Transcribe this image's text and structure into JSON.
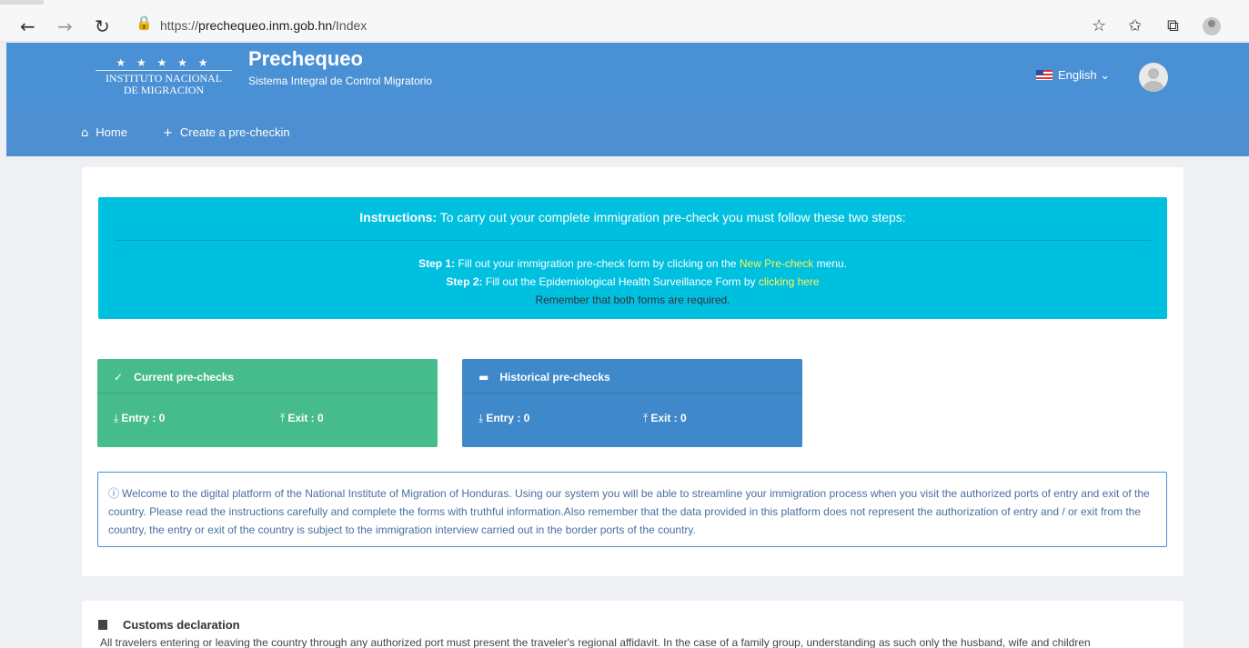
{
  "browser": {
    "url_prefix": "https://",
    "url_host": "prechequeo.inm.gob.hn",
    "url_path": "/Index",
    "back_icon": "back-arrow-icon",
    "forward_icon": "forward-arrow-icon",
    "reload_icon": "reload-icon",
    "lock_icon": "lock-icon"
  },
  "header": {
    "logo_stars": "★ ★ ★ ★ ★",
    "logo_line1": "INSTITUTO NACIONAL",
    "logo_line2": "DE MIGRACION",
    "title": "Prechequeo",
    "subtitle": "Sistema Integral de Control Migratorio",
    "language": "English",
    "language_caret": "⌄"
  },
  "nav": {
    "home": "Home",
    "create": "Create a pre-checkin"
  },
  "instructions": {
    "lead": "Instructions:",
    "heading_text": " To carry out your complete immigration pre-check you must follow these two steps:",
    "step1_label": "Step 1:",
    "step1_text": " Fill out your immigration pre-check form by clicking on the ",
    "step1_link": "New Pre-check",
    "step1_end": " menu.",
    "step2_label": "Step 2:",
    "step2_text": " Fill out the Epidemiological Health Surveillance Form by ",
    "step2_link": "clicking here",
    "reminder": "Remember that both forms are required."
  },
  "current": {
    "title": "Current pre-checks",
    "entry": "Entry : 0",
    "exit": "Exit : 0"
  },
  "historical": {
    "title": "Historical pre-checks",
    "entry": "Entry : 0",
    "exit": "Exit : 0"
  },
  "welcome": {
    "text": "Welcome to the digital platform of the National Institute of Migration of Honduras. Using our system you will be able to streamline your immigration process when you visit the authorized ports of entry and exit of the country. Please read the instructions carefully and complete the forms with truthful information.Also remember that the data provided in this platform does not represent the authorization of entry and / or exit from the country, the entry or exit of the country is subject to the immigration interview carried out in the border ports of the country."
  },
  "customs": {
    "title": "Customs declaration",
    "text": "All travelers entering or leaving the country through any authorized port must present the traveler's regional affidavit. In the case of a family group, understanding as such only the husband, wife and children"
  },
  "colors": {
    "header": "#4a90d4",
    "instructions": "#00c0e0",
    "current_box": "#46bc8c",
    "historical_box": "#3f88c9",
    "link_highlight": "#fff44f"
  }
}
